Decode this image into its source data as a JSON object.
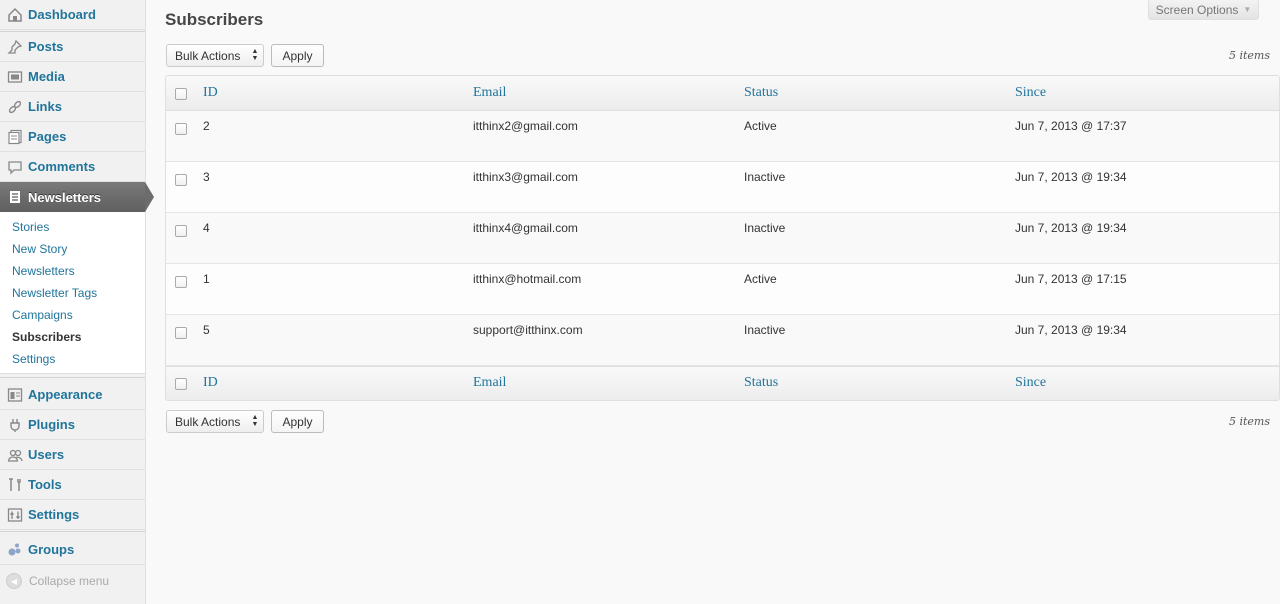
{
  "sidebar": {
    "menu": [
      {
        "key": "dashboard",
        "label": "Dashboard",
        "icon": "dashboard-icon"
      },
      {
        "key": "posts",
        "label": "Posts",
        "icon": "pushpin-icon"
      },
      {
        "key": "media",
        "label": "Media",
        "icon": "media-icon"
      },
      {
        "key": "links",
        "label": "Links",
        "icon": "link-icon"
      },
      {
        "key": "pages",
        "label": "Pages",
        "icon": "pages-icon"
      },
      {
        "key": "comments",
        "label": "Comments",
        "icon": "comment-bubble-icon"
      },
      {
        "key": "newsletters",
        "label": "Newsletters",
        "icon": "newsletter-icon"
      },
      {
        "key": "appearance",
        "label": "Appearance",
        "icon": "appearance-icon"
      },
      {
        "key": "plugins",
        "label": "Plugins",
        "icon": "plug-icon"
      },
      {
        "key": "users",
        "label": "Users",
        "icon": "users-icon"
      },
      {
        "key": "tools",
        "label": "Tools",
        "icon": "tools-icon"
      },
      {
        "key": "settings",
        "label": "Settings",
        "icon": "settings-icon"
      },
      {
        "key": "groups",
        "label": "Groups",
        "icon": "groups-icon"
      }
    ],
    "submenu": [
      "Stories",
      "New Story",
      "Newsletters",
      "Newsletter Tags",
      "Campaigns",
      "Subscribers",
      "Settings"
    ],
    "submenu_current": "Subscribers",
    "collapse_label": "Collapse menu"
  },
  "header": {
    "title": "Subscribers",
    "screen_options": "Screen Options"
  },
  "toolbar": {
    "bulk_actions": "Bulk Actions",
    "apply": "Apply",
    "items_count": "5 items"
  },
  "table": {
    "columns": [
      "ID",
      "Email",
      "Status",
      "Since"
    ],
    "rows": [
      {
        "id": "2",
        "email": "itthinx2@gmail.com",
        "status": "Active",
        "since": "Jun 7, 2013 @ 17:37"
      },
      {
        "id": "3",
        "email": "itthinx3@gmail.com",
        "status": "Inactive",
        "since": "Jun 7, 2013 @ 19:34"
      },
      {
        "id": "4",
        "email": "itthinx4@gmail.com",
        "status": "Inactive",
        "since": "Jun 7, 2013 @ 19:34"
      },
      {
        "id": "1",
        "email": "itthinx@hotmail.com",
        "status": "Active",
        "since": "Jun 7, 2013 @ 17:15"
      },
      {
        "id": "5",
        "email": "support@itthinx.com",
        "status": "Inactive",
        "since": "Jun 7, 2013 @ 19:34"
      }
    ]
  },
  "colors": {
    "link": "#21759b",
    "active_menu": "#6c6c6c"
  }
}
